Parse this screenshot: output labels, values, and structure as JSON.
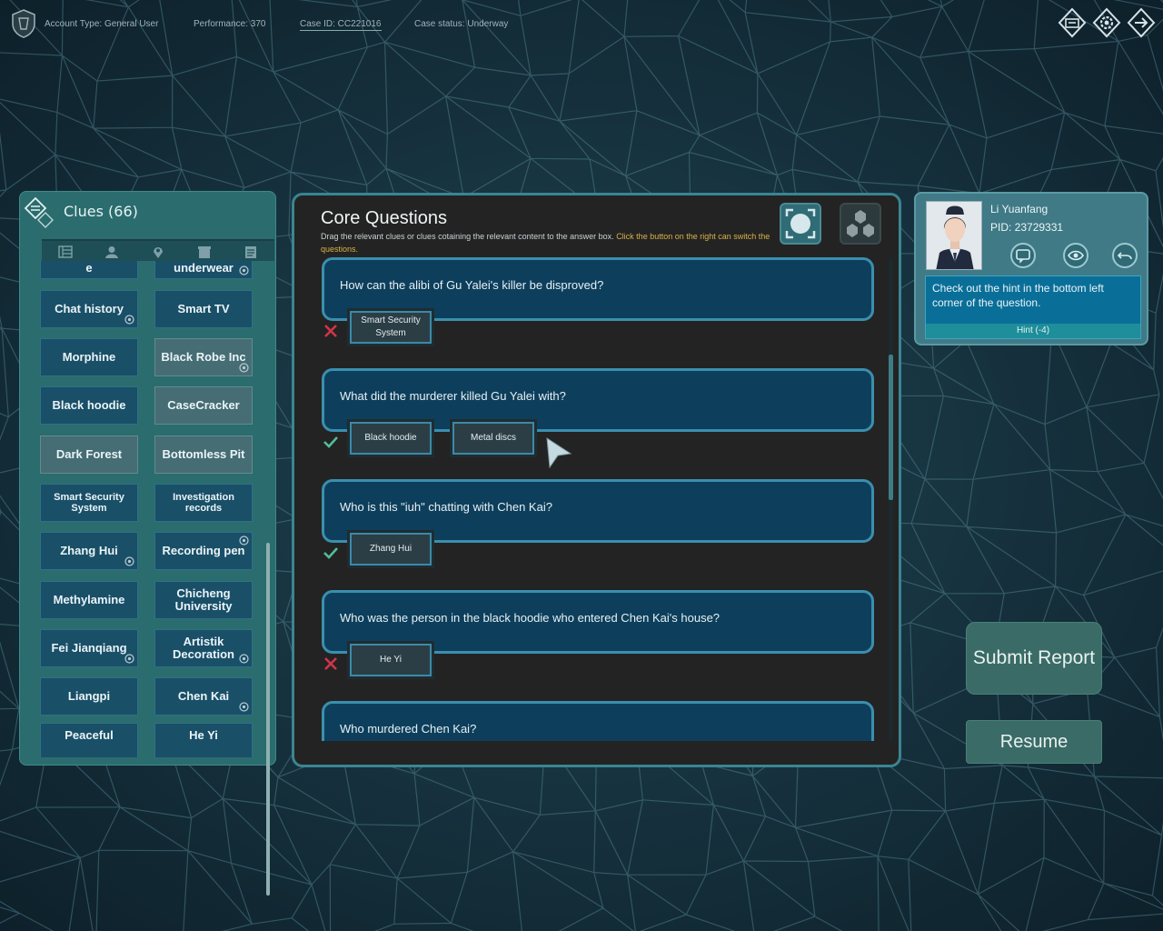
{
  "topbar": {
    "account_type": "Account Type: General User",
    "performance": "Performance: 370",
    "case_id": "Case ID: CC221016",
    "case_status": "Case status: Underway",
    "icons": [
      "clue-board-icon",
      "gear-icon",
      "exit-icon"
    ]
  },
  "clues": {
    "title": "Clues  (66)",
    "tabs": [
      "list-icon",
      "person-icon",
      "location-icon",
      "archive-icon",
      "document-icon"
    ],
    "items": [
      {
        "label": "e",
        "partial": true
      },
      {
        "label": "underwear",
        "partial": true
      },
      {
        "label": "Chat history"
      },
      {
        "label": "Smart TV"
      },
      {
        "label": "Morphine"
      },
      {
        "label": "Black Robe Inc"
      },
      {
        "label": "Black hoodie"
      },
      {
        "label": "CaseCracker"
      },
      {
        "label": "Dark Forest"
      },
      {
        "label": "Bottomless Pit"
      },
      {
        "label": "Smart Security System"
      },
      {
        "label": "Investigation records"
      },
      {
        "label": "Zhang Hui"
      },
      {
        "label": "Recording pen"
      },
      {
        "label": "Methylamine"
      },
      {
        "label": "Chicheng University"
      },
      {
        "label": "Fei Jianqiang"
      },
      {
        "label": "Artistik Decoration"
      },
      {
        "label": "Liangpi"
      },
      {
        "label": "Chen Kai"
      },
      {
        "label": "Peaceful",
        "partial": true
      },
      {
        "label": "He Yi",
        "partial": true
      }
    ]
  },
  "core": {
    "title": "Core Questions",
    "subtitle": "Drag the relevant clues or clues cotaining the relevant content to the answer box. ",
    "subtitle_highlight": "Click the button on the right can switch the questions.",
    "questions": [
      {
        "text": "How can the alibi of Gu Yalei's killer be disproved?",
        "answers": [
          "Smart Security System"
        ],
        "status": "wrong"
      },
      {
        "text": "What did the murderer killed Gu Yalei with?",
        "answers": [
          "Black hoodie",
          "Metal discs"
        ],
        "status": "correct"
      },
      {
        "text": "Who is this \"iuh\" chatting with Chen Kai?",
        "answers": [
          "Zhang Hui"
        ],
        "status": "correct"
      },
      {
        "text": "Who was the person in the black hoodie who entered Chen Kai's house?",
        "answers": [
          "He Yi"
        ],
        "status": "wrong"
      },
      {
        "text": "Who murdered Chen Kai?",
        "answers": [],
        "status": "none"
      }
    ]
  },
  "profile": {
    "name": "Li Yuanfang",
    "pid": "PID:  23729331",
    "hint_text": "Check out the hint in the bottom left corner of the question.",
    "hint_button": "Hint (-4)"
  },
  "actions": {
    "submit": "Submit Report",
    "resume": "Resume"
  },
  "colors": {
    "correct": "#4fbf9a",
    "wrong": "#d2354a",
    "accent": "#3a8fae",
    "highlight": "#d8b24a"
  }
}
